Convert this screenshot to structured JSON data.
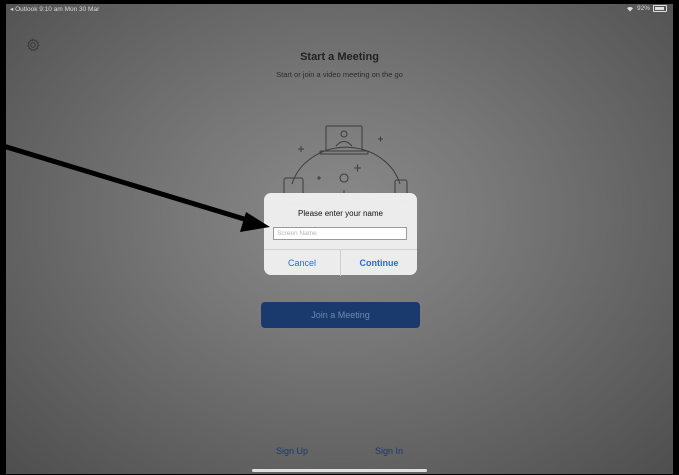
{
  "status_bar": {
    "left": "◂ Outlook  9:10 am  Mon 30 Mar",
    "right": "92%"
  },
  "icons": {
    "settings": "gear-icon",
    "wifi": "wifi-icon",
    "battery": "battery-icon",
    "illustration": "meeting-illustration"
  },
  "main": {
    "title": "Start a Meeting",
    "subtitle": "Start or join a video meeting on the go",
    "join_label": "Join a Meeting"
  },
  "dialog": {
    "title": "Please enter your name",
    "input_placeholder": "Screen Name",
    "input_value": "",
    "cancel_label": "Cancel",
    "continue_label": "Continue"
  },
  "footer": {
    "sign_up": "Sign Up",
    "sign_in": "Sign In"
  },
  "colors": {
    "accent": "#1e6fe0",
    "join_button": "#1a3a6e",
    "annotation_arrow": "#000000"
  }
}
